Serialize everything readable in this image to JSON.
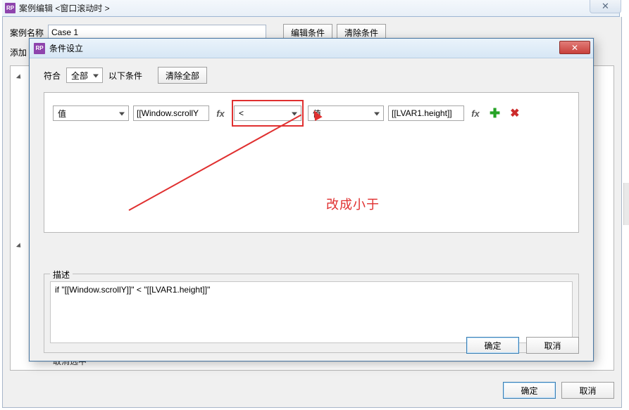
{
  "outer": {
    "title": "案例编辑 <窗口滚动时 >",
    "close_glyph": "✕",
    "case_label": "案例名称",
    "case_value": "Case 1",
    "btn_edit": "编辑条件",
    "btn_clear": "清除条件",
    "add_label": "添加",
    "hidden_row": "取消选中",
    "ok": "确定",
    "cancel": "取消"
  },
  "dialog": {
    "title": "条件设立",
    "close_glyph": "✕",
    "match_label_prefix": "符合",
    "match_combo": "全部",
    "match_label_suffix": "以下条件",
    "clear_all": "清除全部",
    "row": {
      "left_type": "值",
      "left_expr": "[[Window.scrollY",
      "fx1": "fx",
      "op": "<",
      "right_type": "值",
      "right_expr": "[[LVAR1.height]]",
      "fx2": "fx",
      "plus": "✚",
      "del": "✖"
    },
    "annotation": "改成小于",
    "desc_legend": "描述",
    "desc_text": "if \"[[Window.scrollY]]\" < \"[[LVAR1.height]]\"",
    "ok": "确定",
    "cancel": "取消"
  }
}
